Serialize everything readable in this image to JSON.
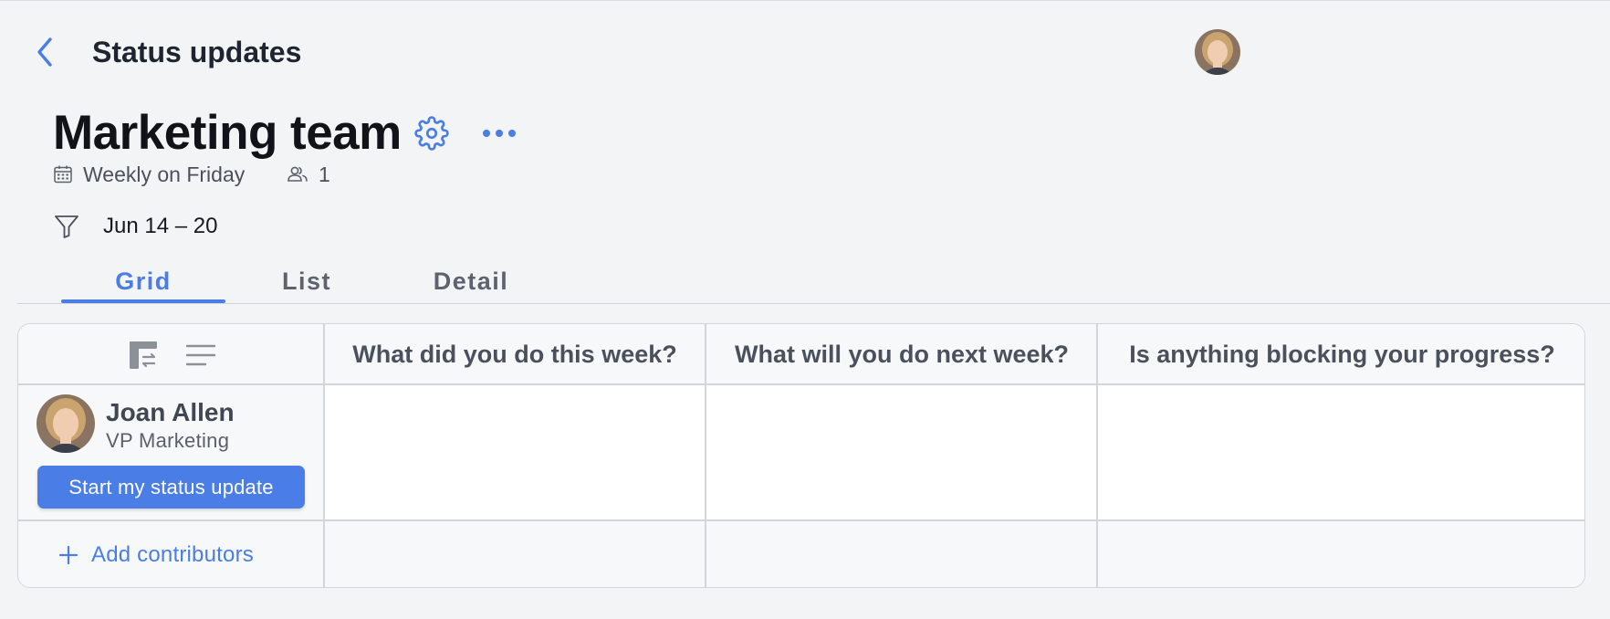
{
  "topbar": {
    "title": "Status updates",
    "back_icon": "chevron-left-icon",
    "avatar_icon": "user-avatar"
  },
  "header": {
    "title": "Marketing team",
    "schedule": "Weekly on Friday",
    "contributors_count": "1",
    "date_range": "Jun 14 – 20"
  },
  "tabs": [
    {
      "label": "Grid",
      "active": true
    },
    {
      "label": "List",
      "active": false
    },
    {
      "label": "Detail",
      "active": false
    }
  ],
  "grid": {
    "questions": [
      "What did you do this week?",
      "What will you do next week?",
      "Is anything blocking your progress?"
    ],
    "rows": [
      {
        "name": "Joan Allen",
        "role": "VP Marketing",
        "action_label": "Start my status update",
        "answers": [
          "",
          "",
          ""
        ]
      }
    ],
    "add_contributors_label": "Add contributors"
  },
  "colors": {
    "accent": "#4a7de6",
    "background": "#f3f4f6",
    "text": "#1f2530"
  }
}
